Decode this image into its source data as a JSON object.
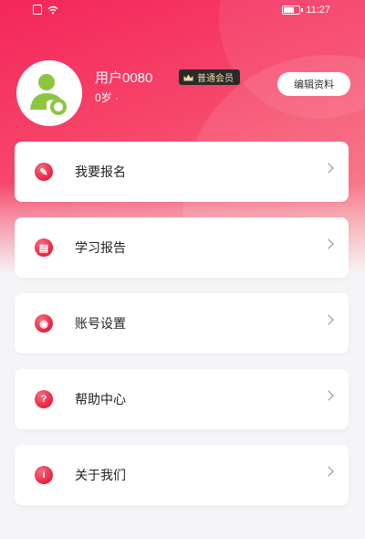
{
  "status_bar": {
    "time": "11:27"
  },
  "profile": {
    "username": "用户0080",
    "membership_badge": "普通会员",
    "age": "0岁 ·",
    "edit_button_label": "编辑资料"
  },
  "menu": {
    "items": [
      {
        "label": "我要报名",
        "icon": "pen-icon",
        "glyph": "✎"
      },
      {
        "label": "学习报告",
        "icon": "report-icon",
        "glyph": "▤"
      },
      {
        "label": "账号设置",
        "icon": "eye-icon",
        "glyph": "◉"
      },
      {
        "label": "帮助中心",
        "icon": "question-icon",
        "glyph": "?"
      },
      {
        "label": "关于我们",
        "icon": "info-icon",
        "glyph": "i"
      }
    ]
  },
  "colors": {
    "header_start": "#f4265b",
    "header_end": "#fa7e86",
    "icon_red": "#e8233f",
    "badge_bg": "#2a2a2a",
    "badge_text": "#f3d9a6",
    "avatar_green": "#8cc63f"
  }
}
